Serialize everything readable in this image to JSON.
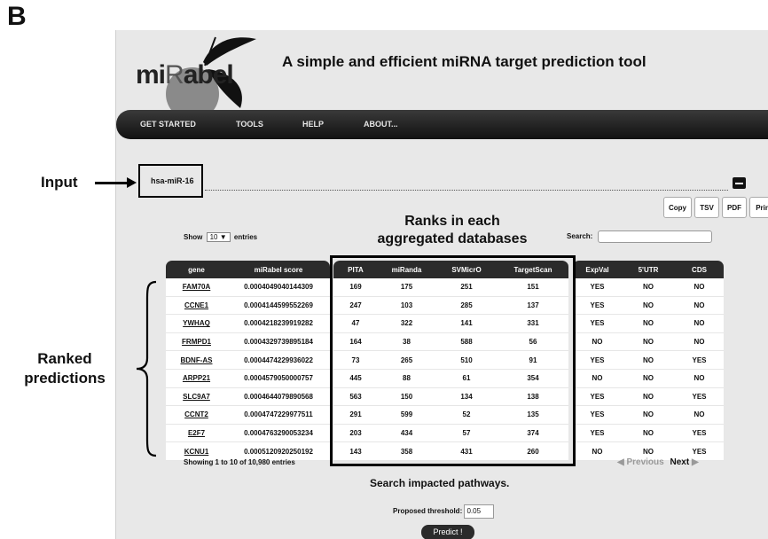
{
  "panel_letter": "B",
  "app": {
    "logo_text_pre": "mi",
    "logo_text_r": "R",
    "logo_text_post": "abel",
    "tagline": "A simple and efficient miRNA target prediction tool",
    "nav": [
      "GET STARTED",
      "TOOLS",
      "HELP",
      "ABOUT..."
    ],
    "input_value": "hsa-miR-16",
    "export_buttons": [
      "Copy",
      "TSV",
      "PDF",
      "Prin"
    ],
    "show_label": "Show",
    "entries_value": "10",
    "entries_label": "entries",
    "search_label": "Search:",
    "columns": [
      "gene",
      "miRabel score",
      "PITA",
      "miRanda",
      "SVMicrO",
      "TargetScan",
      "ExpVal",
      "5'UTR",
      "CDS"
    ],
    "rows": [
      [
        "FAM70A",
        "0.0004049040144309",
        "169",
        "175",
        "251",
        "151",
        "YES",
        "NO",
        "NO"
      ],
      [
        "CCNE1",
        "0.0004144599552269",
        "247",
        "103",
        "285",
        "137",
        "YES",
        "NO",
        "NO"
      ],
      [
        "YWHAQ",
        "0.0004218239919282",
        "47",
        "322",
        "141",
        "331",
        "YES",
        "NO",
        "NO"
      ],
      [
        "FRMPD1",
        "0.0004329739895184",
        "164",
        "38",
        "588",
        "56",
        "NO",
        "NO",
        "NO"
      ],
      [
        "BDNF-AS",
        "0.0004474229936022",
        "73",
        "265",
        "510",
        "91",
        "YES",
        "NO",
        "YES"
      ],
      [
        "ARPP21",
        "0.0004579050000757",
        "445",
        "88",
        "61",
        "354",
        "NO",
        "NO",
        "NO"
      ],
      [
        "SLC9A7",
        "0.0004644079890568",
        "563",
        "150",
        "134",
        "138",
        "YES",
        "NO",
        "YES"
      ],
      [
        "CCNT2",
        "0.0004747229977511",
        "291",
        "599",
        "52",
        "135",
        "YES",
        "NO",
        "NO"
      ],
      [
        "E2F7",
        "0.0004763290053234",
        "203",
        "434",
        "57",
        "374",
        "YES",
        "NO",
        "YES"
      ],
      [
        "KCNU1",
        "0.0005120920250192",
        "143",
        "358",
        "431",
        "260",
        "NO",
        "NO",
        "YES"
      ]
    ],
    "showing_text": "Showing 1 to 10 of 10,980 entries",
    "prev_label": "Previous",
    "next_label": "Next",
    "pathways_title": "Search impacted pathways.",
    "threshold_label": "Proposed threshold:",
    "threshold_value": "0.05",
    "predict_label": "Predict !"
  },
  "annotations": {
    "input": "Input",
    "ranks_line1": "Ranks in each",
    "ranks_line2": "aggregated databases",
    "ranked_line1": "Ranked",
    "ranked_line2": "predictions"
  },
  "colors": {
    "app_background": "#e8e8e8",
    "header_dark": "#2b2b2b",
    "logo_leaf": "#111111",
    "logo_fruit": "#8a8a8a"
  }
}
